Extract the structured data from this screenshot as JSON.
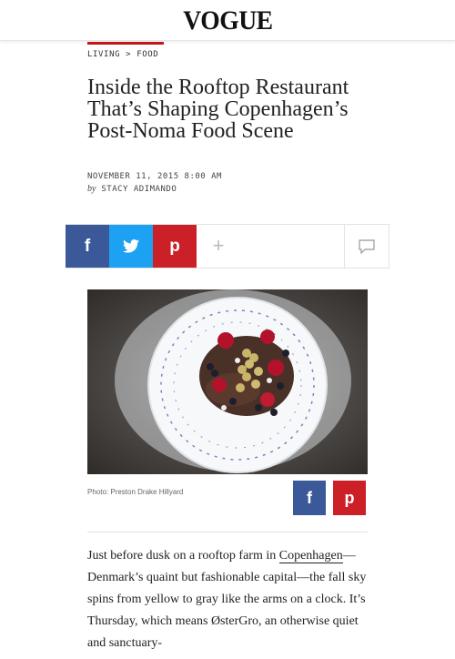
{
  "header": {
    "logo": "VOGUE"
  },
  "breadcrumb": {
    "section": "LIVING",
    "separator": ">",
    "subsection": "FOOD"
  },
  "article": {
    "title": "Inside the Rooftop Restaurant That’s Shaping Copenhagen’s Post-Noma Food Scene",
    "date": "NOVEMBER 11, 2015 8:00 AM",
    "by_label": "by",
    "author": "STACY ADIMANDO",
    "photo_caption": "Photo: Preston Drake Hillyard",
    "body": {
      "text1": "Just before dusk on a rooftop farm in ",
      "link": "Copenhagen",
      "text2": "—Denmark’s quaint but fashionable capital—the fall sky spins from yellow to gray like the arms on a clock. It’s Thursday, which means ØsterGro, an otherwise quiet and sanctuary-"
    }
  },
  "share": {
    "facebook": "f",
    "twitter": "twitter-bird-icon",
    "pinterest": "p",
    "more": "+",
    "comment": "comment-icon"
  },
  "colors": {
    "facebook": "#3b5998",
    "twitter": "#1da1f2",
    "pinterest": "#cb2027",
    "accent": "#c4151c"
  }
}
